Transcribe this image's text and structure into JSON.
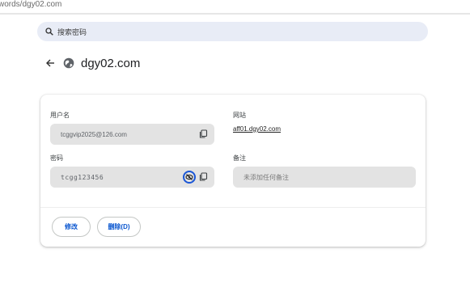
{
  "browser": {
    "url_fragment": "words/dgy02.com"
  },
  "search": {
    "placeholder": "搜索密码"
  },
  "header": {
    "title": "dgy02.com"
  },
  "details": {
    "username_label": "用户名",
    "username_value": "tcggvip2025@126.com",
    "password_label": "密码",
    "password_value": "tcgg123456",
    "website_label": "网站",
    "website_value": "aff01.dgy02.com",
    "notes_label": "备注",
    "notes_placeholder": "未添加任何备注"
  },
  "actions": {
    "edit_label": "修改",
    "delete_label": "删除(D)"
  },
  "colors": {
    "accent": "#0b57d0",
    "field_bg": "#e3e3e3",
    "search_bg": "#e8ecf6"
  },
  "icons": [
    "search-icon",
    "back-arrow-icon",
    "globe-icon",
    "copy-icon",
    "eye-off-icon"
  ]
}
